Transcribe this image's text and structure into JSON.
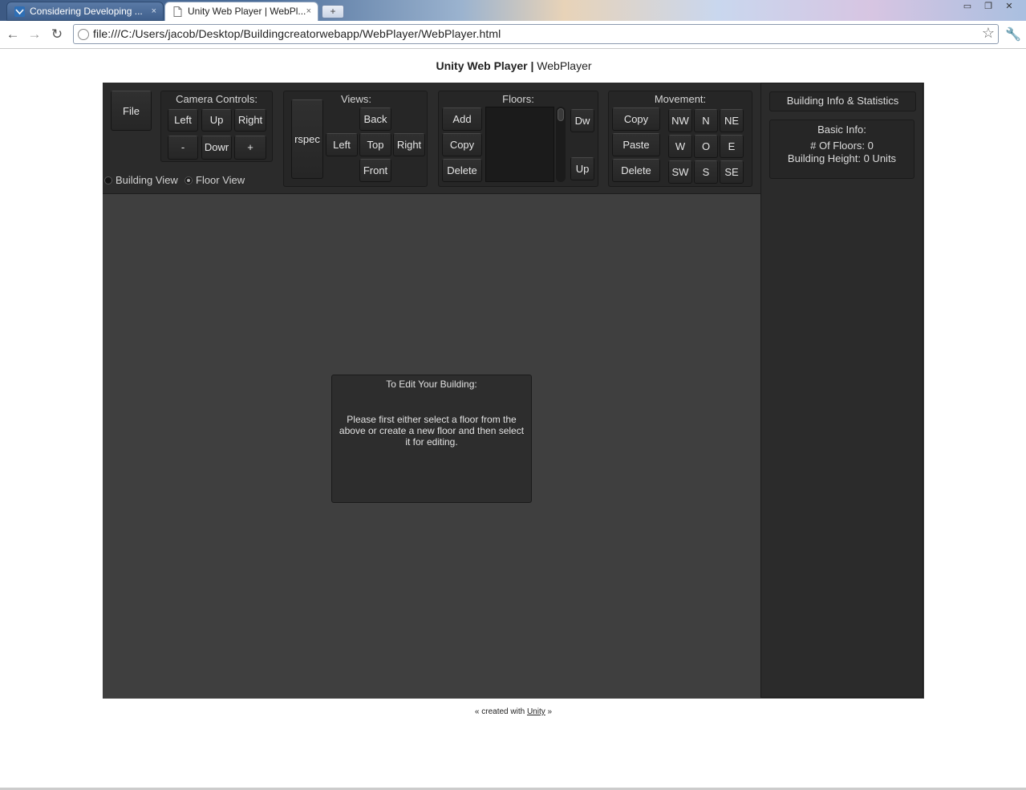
{
  "browser": {
    "tabs": [
      {
        "title": "Considering Developing ...",
        "active": false
      },
      {
        "title": "Unity Web Player | WebPl...",
        "active": true
      }
    ],
    "close_glyph": "×",
    "new_tab_glyph": "+",
    "url": "file:///C:/Users/jacob/Desktop/Buildingcreatorwebapp/WebPlayer/WebPlayer.html",
    "window_controls": [
      "▭",
      "❐",
      "✕"
    ]
  },
  "page": {
    "title_bold": "Unity Web Player |",
    "title_rest": " WebPlayer",
    "footer_prefix": "« created with ",
    "footer_link": "Unity",
    "footer_suffix": " »"
  },
  "app": {
    "file_label": "File",
    "camera": {
      "title": "Camera Controls:",
      "left": "Left",
      "up": "Up",
      "right": "Right",
      "minus": "-",
      "down": "Dowr",
      "plus": "+"
    },
    "views": {
      "title": "Views:",
      "perspective": "rspec",
      "back": "Back",
      "left": "Left",
      "top": "Top",
      "right": "Right",
      "front": "Front"
    },
    "floors": {
      "title": "Floors:",
      "add": "Add",
      "copy": "Copy",
      "delete": "Delete",
      "down": "Dw",
      "up": "Up"
    },
    "movement": {
      "title": "Movement:",
      "copy": "Copy",
      "paste": "Paste",
      "delete": "Delete",
      "nw": "NW",
      "n": "N",
      "ne": "NE",
      "w": "W",
      "o": "O",
      "e": "E",
      "sw": "SW",
      "s": "S",
      "se": "SE"
    },
    "view_mode": {
      "building": "Building View",
      "floor": "Floor View",
      "selected": "floor"
    },
    "side": {
      "header": "Building Info & Statistics",
      "basic_title": "Basic Info:",
      "floors_line": "# Of Floors: 0",
      "height_line": "Building Height: 0 Units"
    },
    "message": {
      "title": "To Edit Your Building:",
      "body": "Please first either select a floor from the above or create a new floor and then select it for editing."
    }
  }
}
